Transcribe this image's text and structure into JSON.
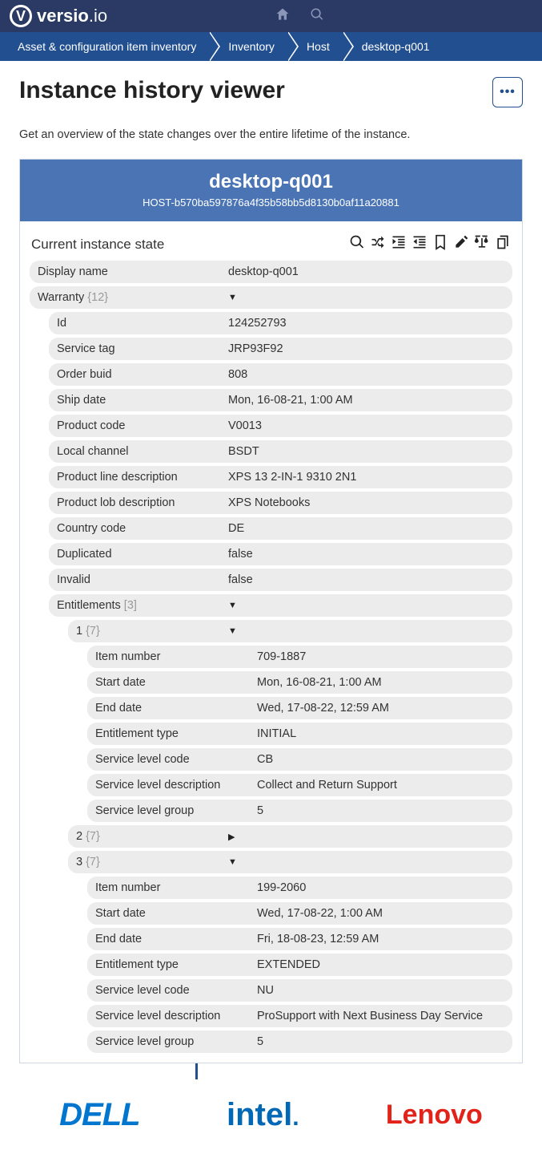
{
  "brand": {
    "main": "versio",
    "suffix": ".io"
  },
  "breadcrumb": {
    "items": [
      "Asset & configuration item inventory",
      "Inventory",
      "Host",
      "desktop-q001"
    ]
  },
  "page": {
    "title": "Instance history viewer",
    "subtitle": "Get an overview of the state changes over the entire lifetime of the instance."
  },
  "instance": {
    "title": "desktop-q001",
    "id": "HOST-b570ba597876a4f35b58bb5d8130b0af11a20881"
  },
  "state": {
    "title": "Current instance state",
    "display_name": {
      "label": "Display name",
      "value": "desktop-q001"
    },
    "warranty": {
      "label": "Warranty",
      "count": "{12}",
      "fields": {
        "id": {
          "label": "Id",
          "value": "124252793"
        },
        "service_tag": {
          "label": "Service tag",
          "value": "JRP93F92"
        },
        "order_buid": {
          "label": "Order buid",
          "value": "808"
        },
        "ship_date": {
          "label": "Ship date",
          "value": "Mon, 16-08-21, 1:00 AM"
        },
        "product_code": {
          "label": "Product code",
          "value": "V0013"
        },
        "local_channel": {
          "label": "Local channel",
          "value": "BSDT"
        },
        "product_line_desc": {
          "label": "Product line description",
          "value": "XPS 13 2-IN-1 9310 2N1"
        },
        "product_lob_desc": {
          "label": "Product lob description",
          "value": "XPS Notebooks"
        },
        "country_code": {
          "label": "Country code",
          "value": "DE"
        },
        "duplicated": {
          "label": "Duplicated",
          "value": "false"
        },
        "invalid": {
          "label": "Invalid",
          "value": "false"
        }
      },
      "entitlements": {
        "label": "Entitlements",
        "count": "[3]",
        "items": {
          "e1": {
            "label": "1",
            "count": "{7}",
            "expanded": true,
            "fields": {
              "item_number": {
                "label": "Item number",
                "value": "709-1887"
              },
              "start_date": {
                "label": "Start date",
                "value": "Mon, 16-08-21, 1:00 AM"
              },
              "end_date": {
                "label": "End date",
                "value": "Wed, 17-08-22, 12:59 AM"
              },
              "entitlement_type": {
                "label": "Entitlement type",
                "value": "INITIAL"
              },
              "service_level_code": {
                "label": "Service level code",
                "value": "CB"
              },
              "service_level_desc": {
                "label": "Service level description",
                "value": "Collect and Return Support"
              },
              "service_level_group": {
                "label": "Service level group",
                "value": "5"
              }
            }
          },
          "e2": {
            "label": "2",
            "count": "{7}",
            "expanded": false
          },
          "e3": {
            "label": "3",
            "count": "{7}",
            "expanded": true,
            "fields": {
              "item_number": {
                "label": "Item number",
                "value": "199-2060"
              },
              "start_date": {
                "label": "Start date",
                "value": "Wed, 17-08-22, 1:00 AM"
              },
              "end_date": {
                "label": "End date",
                "value": "Fri, 18-08-23, 12:59 AM"
              },
              "entitlement_type": {
                "label": "Entitlement type",
                "value": "EXTENDED"
              },
              "service_level_code": {
                "label": "Service level code",
                "value": "NU"
              },
              "service_level_desc": {
                "label": "Service level description",
                "value": "ProSupport with Next Business Day Service"
              },
              "service_level_group": {
                "label": "Service level group",
                "value": "5"
              }
            }
          }
        }
      }
    }
  },
  "footer": {
    "dell": "DELL",
    "intel": "intel",
    "lenovo": "Lenovo"
  },
  "more_dots": "•••"
}
